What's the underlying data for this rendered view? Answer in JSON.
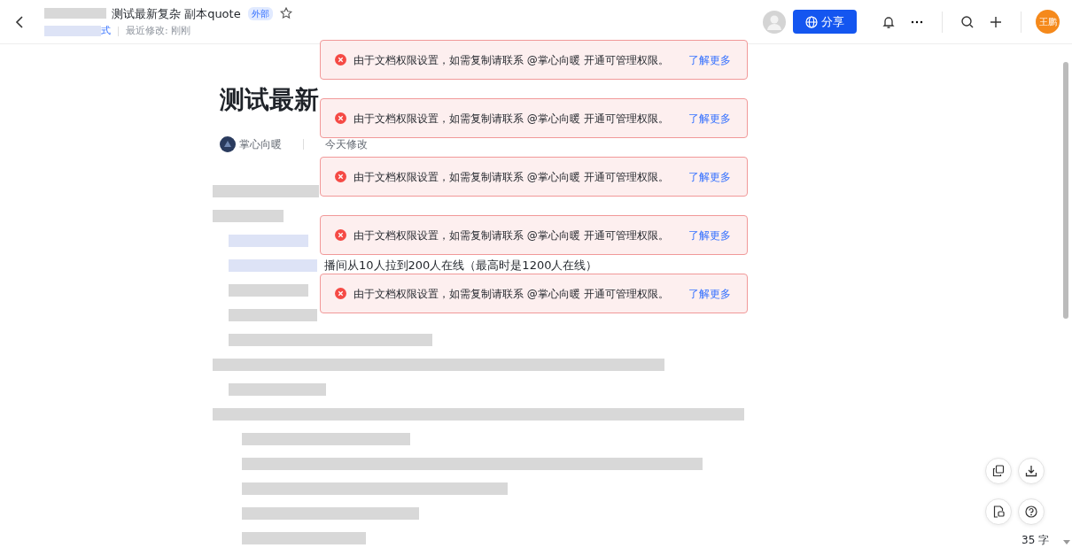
{
  "header": {
    "breadcrumb_tail": "式",
    "title": "测试最新复杂 副本quote",
    "badge": "外部",
    "starred": false,
    "last_modified": "最近修改: 刚刚",
    "share_button": "分享",
    "user_avatar": "王鹏"
  },
  "document": {
    "heading": "测试最新",
    "author": "掌心向暖",
    "modified": "今天修改",
    "visible_line": "播间从10人拉到200人在线（最高时是1200人在线）"
  },
  "toasts": [
    {
      "message": "由于文档权限设置，如需复制请联系 @掌心向暖 开通可管理权限。",
      "link": "了解更多"
    },
    {
      "message": "由于文档权限设置，如需复制请联系 @掌心向暖 开通可管理权限。",
      "link": "了解更多"
    },
    {
      "message": "由于文档权限设置，如需复制请联系 @掌心向暖 开通可管理权限。",
      "link": "了解更多"
    },
    {
      "message": "由于文档权限设置，如需复制请联系 @掌心向暖 开通可管理权限。",
      "link": "了解更多"
    },
    {
      "message": "由于文档权限设置，如需复制请联系 @掌心向暖 开通可管理权限。",
      "link": "了解更多"
    }
  ],
  "word_count": "35 字"
}
